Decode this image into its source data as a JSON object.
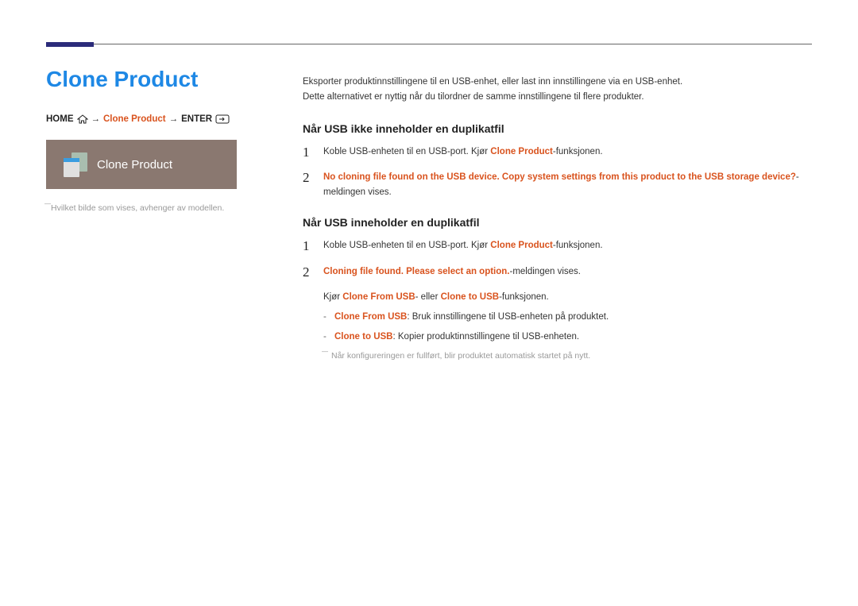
{
  "title": "Clone Product",
  "breadcrumb": {
    "home": "HOME",
    "clone": "Clone Product",
    "enter": "ENTER",
    "arrow": "→"
  },
  "uibox": {
    "label": "Clone Product"
  },
  "caption": "Hvilket bilde som vises, avhenger av modellen.",
  "intro": {
    "line1": "Eksporter produktinnstillingene til en USB-enhet, eller last inn innstillingene via en USB-enhet.",
    "line2": "Dette alternativet er nyttig når du tilordner de samme innstillingene til flere produkter."
  },
  "section1": {
    "heading": "Når USB ikke inneholder en duplikatfil",
    "step1_a": "Koble USB-enheten til en USB-port. Kjør ",
    "step1_b": "Clone Product",
    "step1_c": "-funksjonen.",
    "step2_a": "No cloning file found on the USB device. Copy system settings from this product to the USB storage device?",
    "step2_b": "-meldingen vises."
  },
  "section2": {
    "heading": "Når USB inneholder en duplikatfil",
    "step1_a": "Koble USB-enheten til en USB-port. Kjør ",
    "step1_b": "Clone Product",
    "step1_c": "-funksjonen.",
    "step2_a": "Cloning file found. Please select an option.",
    "step2_b": "-meldingen vises.",
    "after_a": "Kjør ",
    "after_b": "Clone From USB",
    "after_c": "- eller ",
    "after_d": "Clone to USB",
    "after_e": "-funksjonen.",
    "dash1_a": "Clone From USB",
    "dash1_b": ": Bruk innstillingene til USB-enheten på produktet.",
    "dash2_a": "Clone to USB",
    "dash2_b": ": Kopier produktinnstillingene til USB-enheten.",
    "footnote": "Når konfigureringen er fullført, blir produktet automatisk startet på nytt."
  }
}
